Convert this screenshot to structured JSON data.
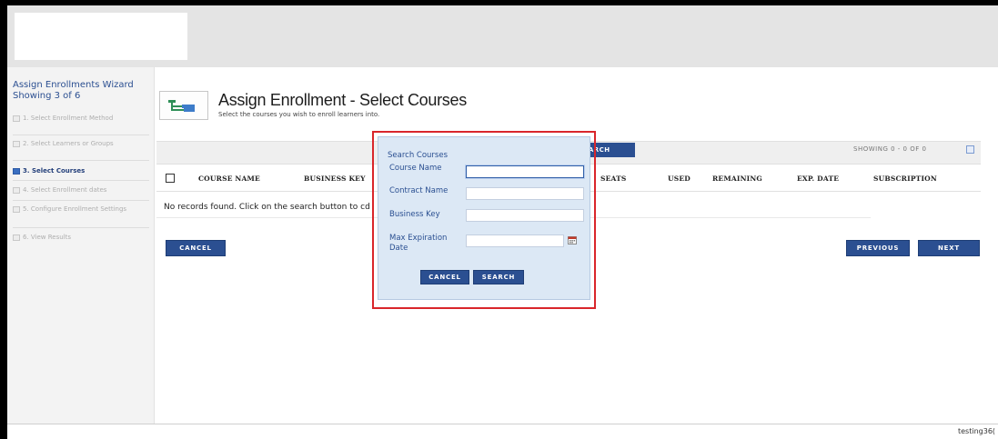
{
  "wizard": {
    "title": "Assign Enrollments Wizard",
    "progress": "Showing 3 of 6",
    "steps": [
      {
        "label": "1. Select Enrollment Method",
        "state": "done"
      },
      {
        "label": "2. Select Learners or Groups",
        "state": "done"
      },
      {
        "label": "3. Select Courses",
        "state": "active"
      },
      {
        "label": "4. Select Enrollment dates",
        "state": "pending"
      },
      {
        "label": "5. Configure Enrollment Settings",
        "state": "pending"
      },
      {
        "label": "6. View Results",
        "state": "pending"
      }
    ]
  },
  "page": {
    "title": "Assign Enrollment - Select Courses",
    "subtitle": "Select the courses you wish to enroll learners into.",
    "icon": "enrollment-tree-icon"
  },
  "grid": {
    "search_button": "SEARCH",
    "showing": "SHOWING 0 - 0 OF 0",
    "columns": [
      "COURSE NAME",
      "BUSINESS KEY",
      "SEATS",
      "USED",
      "REMAINING",
      "EXP. DATE",
      "SUBSCRIPTION"
    ],
    "no_records": "No records found. Click on the search button to cd"
  },
  "buttons": {
    "cancel": "CANCEL",
    "previous": "PREVIOUS",
    "next": "NEXT"
  },
  "modal": {
    "title": "Search Courses",
    "fields": {
      "course_name": {
        "label": "Course Name",
        "value": ""
      },
      "contract_name": {
        "label": "Contract Name",
        "value": ""
      },
      "business_key": {
        "label": "Business Key",
        "value": ""
      },
      "max_expiration": {
        "label": "Max Expiration Date",
        "value": ""
      }
    },
    "cancel": "CANCEL",
    "search": "SEARCH"
  },
  "footer": {
    "text": "testing36("
  },
  "colors": {
    "brand_blue": "#2b4f91",
    "modal_bg": "#dce8f5",
    "highlight_red": "#d9262b"
  }
}
